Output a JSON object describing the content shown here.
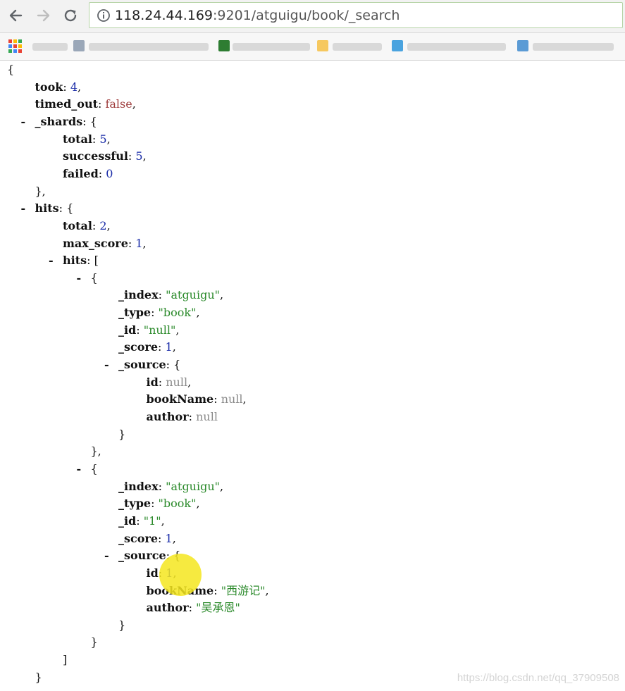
{
  "browser": {
    "url_host": "118.24.44.169",
    "url_rest": ":9201/atguigu/book/_search",
    "back_icon": "arrow-left-icon",
    "forward_icon": "arrow-right-icon",
    "reload_icon": "reload-icon",
    "info_icon": "info-icon",
    "apps_icon": "apps-grid-icon"
  },
  "json_lines": [
    {
      "depth": 0,
      "toggle": "",
      "text": "{"
    },
    {
      "depth": 1,
      "key": "took",
      "value": "4",
      "vtype": "num",
      "tail": ","
    },
    {
      "depth": 1,
      "key": "timed_out",
      "value": "false",
      "vtype": "kw",
      "tail": ","
    },
    {
      "depth": 1,
      "toggle": "-",
      "key": "_shards",
      "tail": "{"
    },
    {
      "depth": 2,
      "key": "total",
      "value": "5",
      "vtype": "num",
      "tail": ","
    },
    {
      "depth": 2,
      "key": "successful",
      "value": "5",
      "vtype": "num",
      "tail": ","
    },
    {
      "depth": 2,
      "key": "failed",
      "value": "0",
      "vtype": "num",
      "tail": ""
    },
    {
      "depth": 1,
      "text": "},"
    },
    {
      "depth": 1,
      "toggle": "-",
      "key": "hits",
      "tail": "{"
    },
    {
      "depth": 2,
      "key": "total",
      "value": "2",
      "vtype": "num",
      "tail": ","
    },
    {
      "depth": 2,
      "key": "max_score",
      "value": "1",
      "vtype": "num",
      "tail": ","
    },
    {
      "depth": 2,
      "toggle": "-",
      "key": "hits",
      "tail": "["
    },
    {
      "depth": 3,
      "toggle": "-",
      "text": "{"
    },
    {
      "depth": 4,
      "key": "_index",
      "value": "\"atguigu\"",
      "vtype": "str",
      "tail": ","
    },
    {
      "depth": 4,
      "key": "_type",
      "value": "\"book\"",
      "vtype": "str",
      "tail": ","
    },
    {
      "depth": 4,
      "key": "_id",
      "value": "\"null\"",
      "vtype": "str",
      "tail": ","
    },
    {
      "depth": 4,
      "key": "_score",
      "value": "1",
      "vtype": "num",
      "tail": ","
    },
    {
      "depth": 4,
      "toggle": "-",
      "key": "_source",
      "tail": "{"
    },
    {
      "depth": 5,
      "key": "id",
      "value": "null",
      "vtype": "nul",
      "tail": ","
    },
    {
      "depth": 5,
      "key": "bookName",
      "value": "null",
      "vtype": "nul",
      "tail": ","
    },
    {
      "depth": 5,
      "key": "author",
      "value": "null",
      "vtype": "nul",
      "tail": ""
    },
    {
      "depth": 4,
      "text": "}"
    },
    {
      "depth": 3,
      "text": "},"
    },
    {
      "depth": 3,
      "toggle": "-",
      "text": "{"
    },
    {
      "depth": 4,
      "key": "_index",
      "value": "\"atguigu\"",
      "vtype": "str",
      "tail": ","
    },
    {
      "depth": 4,
      "key": "_type",
      "value": "\"book\"",
      "vtype": "str",
      "tail": ","
    },
    {
      "depth": 4,
      "key": "_id",
      "value": "\"1\"",
      "vtype": "str",
      "tail": ","
    },
    {
      "depth": 4,
      "key": "_score",
      "value": "1",
      "vtype": "num",
      "tail": ","
    },
    {
      "depth": 4,
      "toggle": "-",
      "key": "_source",
      "tail": "{"
    },
    {
      "depth": 5,
      "key": "id",
      "value": "1",
      "vtype": "num",
      "tail": ","
    },
    {
      "depth": 5,
      "key": "bookName",
      "value": "\"西游记\"",
      "vtype": "str",
      "tail": ","
    },
    {
      "depth": 5,
      "key": "author",
      "value": "\"吴承恩\"",
      "vtype": "str",
      "tail": ""
    },
    {
      "depth": 4,
      "text": "}"
    },
    {
      "depth": 3,
      "text": "}"
    },
    {
      "depth": 2,
      "text": "]"
    },
    {
      "depth": 1,
      "text": "}"
    }
  ],
  "watermark": "https://blog.csdn.net/qq_37909508",
  "colors": {
    "number": "#1a2ca8",
    "string": "#2b8a2b",
    "keyword": "#a04040",
    "null": "#8a8a8a",
    "cursor_highlight": "#f5e61e"
  }
}
